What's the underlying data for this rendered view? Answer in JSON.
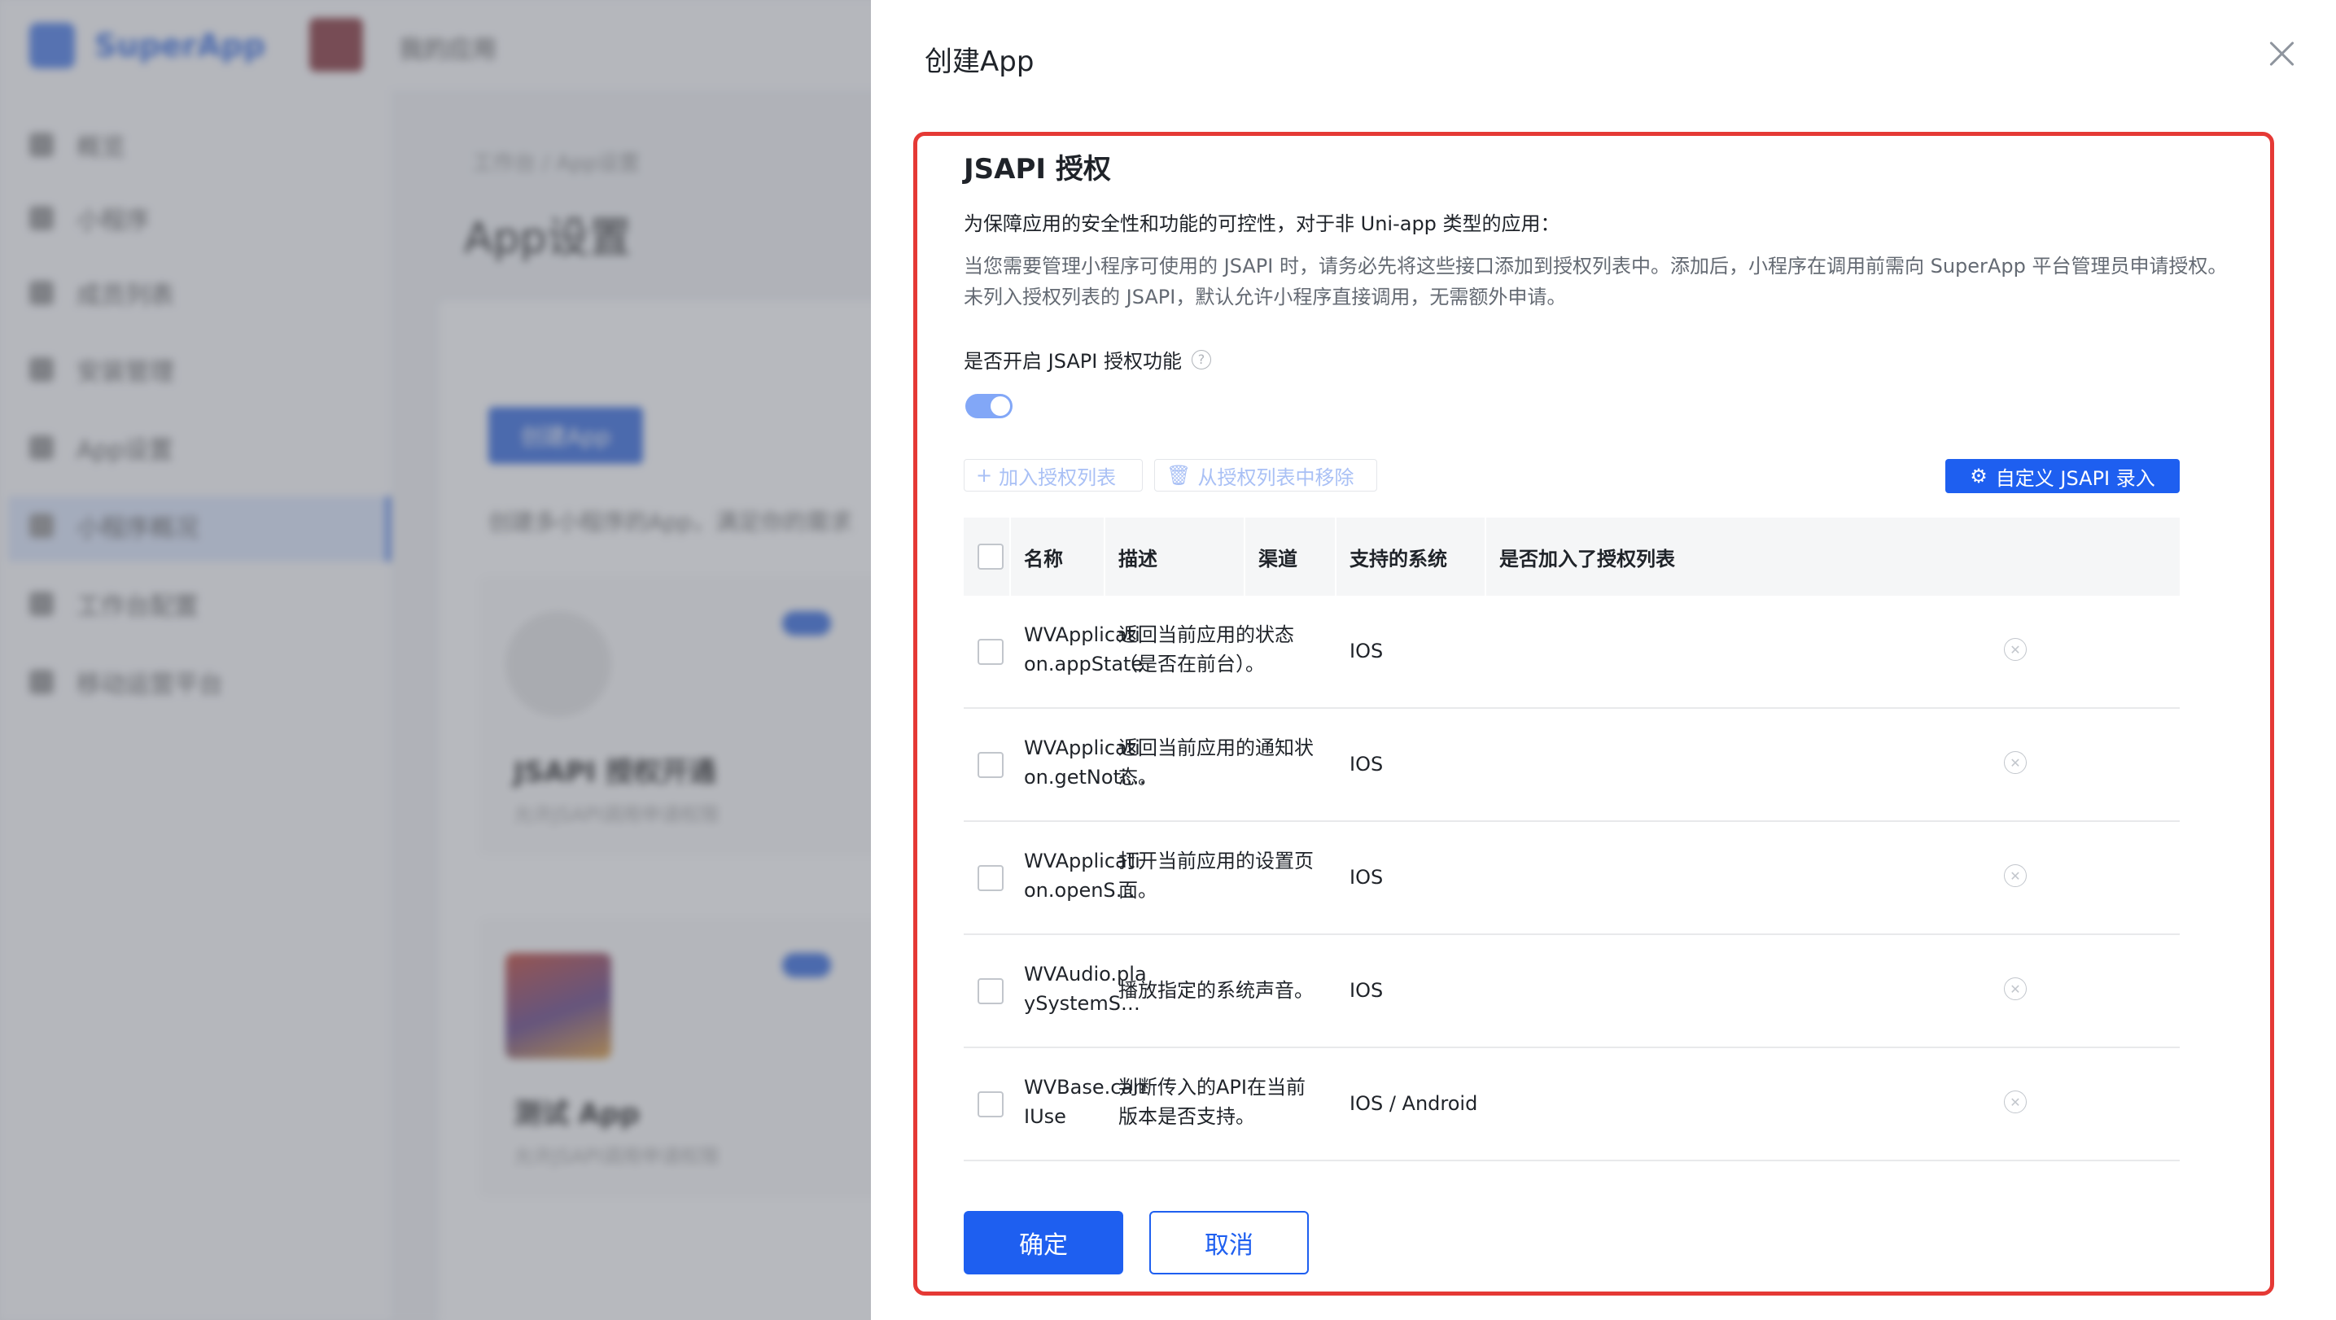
{
  "background_app": {
    "brand": "SuperApp",
    "app_selector": "我的应用",
    "sidebar": [
      "概览",
      "小程序",
      "成员列表",
      "安装管理",
      "App设置",
      "小程序概况",
      "工作台配置",
      "移动运营平台"
    ],
    "breadcrumb": "工作台 / App设置",
    "page_title": "App设置",
    "create_button": "创建App",
    "description": "创建多小程序的App，满足你的需求",
    "cards": [
      {
        "name": "JSAPI 授权开通",
        "sub": "允许JSAPI调用申请权限"
      },
      {
        "name": "测试 App",
        "sub": "允许JSAPI调用申请权限"
      }
    ]
  },
  "drawer": {
    "title": "创建App",
    "section_title": "JSAPI 授权",
    "intro_strong": "为保障应用的安全性和功能的可控性，对于非 Uni-app 类型的应用：",
    "intro_para": "当您需要管理小程序可使用的 JSAPI 时，请务必先将这些接口添加到授权列表中。添加后，小程序在调用前需向 SuperApp 平台管理员申请授权。未列入授权列表的 JSAPI，默认允许小程序直接调用，无需额外申请。",
    "switch_label": "是否开启 JSAPI 授权功能",
    "switch_on": true,
    "add_button": "加入授权列表",
    "remove_button": "从授权列表中移除",
    "custom_button": "自定义 JSAPI 录入",
    "table": {
      "headers": {
        "name": "名称",
        "desc": "描述",
        "channel": "渠道",
        "system": "支持的系统",
        "in_list": "是否加入了授权列表"
      },
      "rows": [
        {
          "name1": "WVApplicati",
          "name2": "on.appState",
          "desc1": "返回当前应用的状态",
          "desc2": "（是否在前台）。",
          "channel": "",
          "system": "IOS"
        },
        {
          "name1": "WVApplicati",
          "name2": "on.getNoti…",
          "desc1": "返回当前应用的通知状",
          "desc2": "态。",
          "channel": "",
          "system": "IOS"
        },
        {
          "name1": "WVApplicati",
          "name2": "on.openS…",
          "desc1": "打开当前应用的设置页",
          "desc2": "面。",
          "channel": "",
          "system": "IOS"
        },
        {
          "name1": "WVAudio.pla",
          "name2": "ySystemS…",
          "desc1": "播放指定的系统声音。",
          "desc2": "",
          "channel": "",
          "system": "IOS"
        },
        {
          "name1": "WVBase.can",
          "name2": "IUse",
          "desc1": "判断传入的API在当前",
          "desc2": "版本是否支持。",
          "channel": "",
          "system": "IOS / Android"
        }
      ]
    },
    "confirm_button": "确定",
    "cancel_button": "取消",
    "colors": {
      "primary": "#1e5ff0",
      "highlight": "#e53935"
    }
  }
}
